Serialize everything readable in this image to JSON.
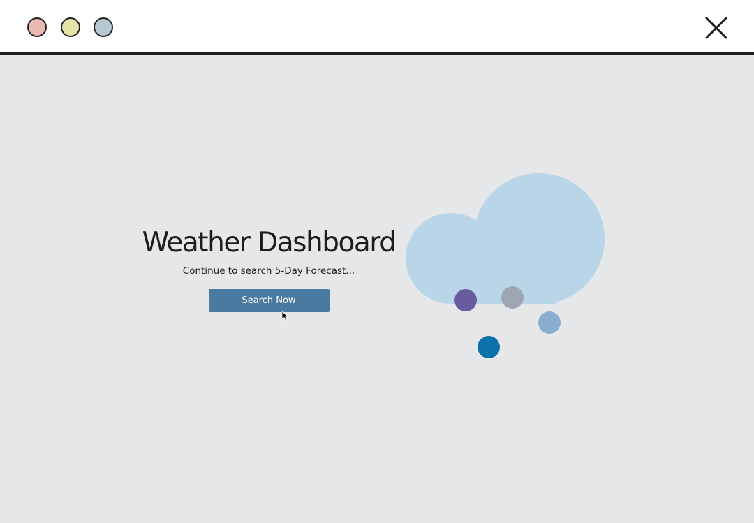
{
  "window": {
    "controls": {
      "close_icon": "close-icon",
      "minimize_color": "#eab8b2",
      "maximize_color": "#e4e4a8",
      "third_color": "#b6c9d3"
    }
  },
  "hero": {
    "title": "Weather Dashboard",
    "subtitle": "Continue to search 5-Day Forecast...",
    "cta_label": "Search Now"
  },
  "illustration": {
    "cloud_icon": "cloud-icon",
    "cloud_color": "#b8d6e8",
    "rain_colors": [
      "#6a5a9e",
      "#9ea6b2",
      "#89aed0",
      "#0a72a8"
    ]
  },
  "colors": {
    "background": "#e6e7e9",
    "button": "#4a7aa0",
    "titlebar": "#ffffff",
    "divider": "#1f1f1f"
  }
}
